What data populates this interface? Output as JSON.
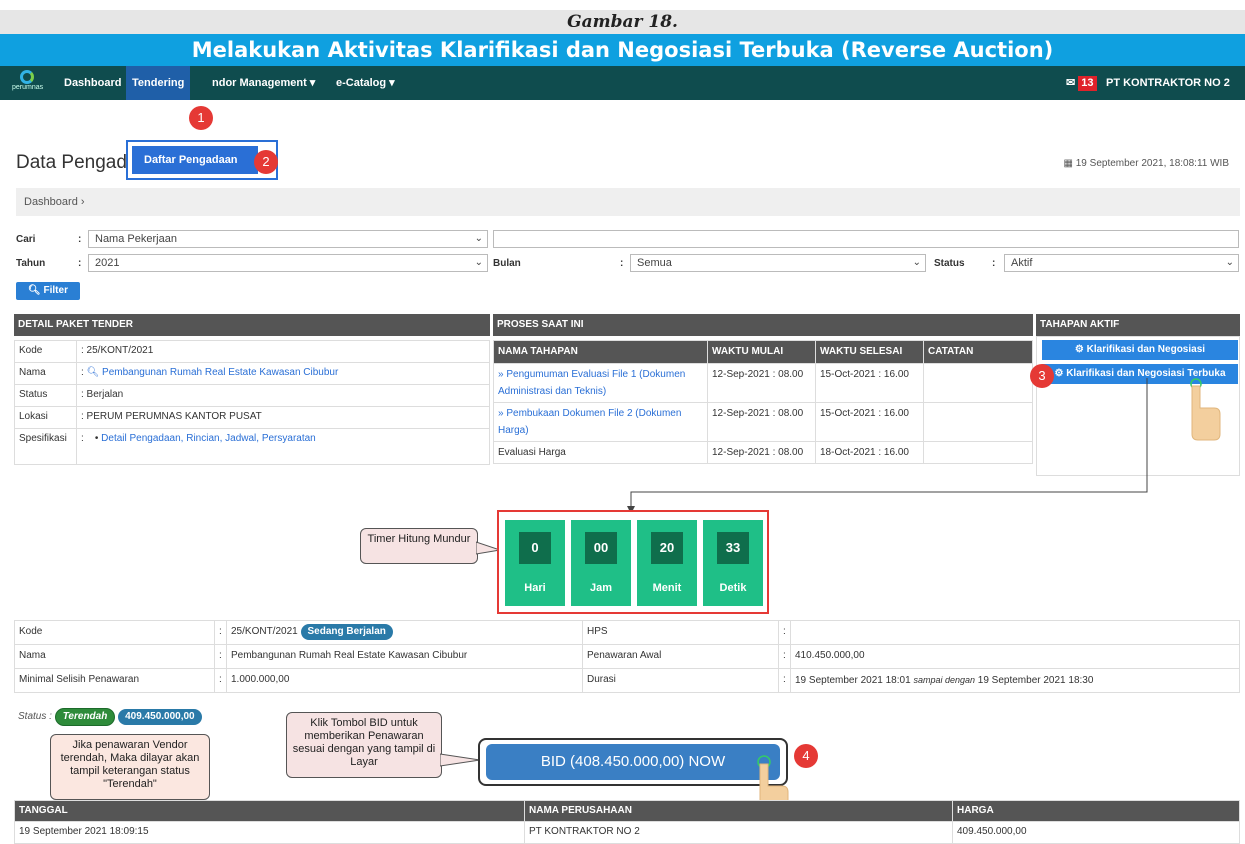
{
  "caption": "Gambar 18.",
  "banner": "Melakukan Aktivitas Klarifikasi dan Negosiasi Terbuka (Reverse Auction)",
  "navbar": {
    "logo_text": "perumnas",
    "dashboard": "Dashboard",
    "tendering": "Tendering",
    "vendor": "ndor Management ▾",
    "ecatalog": "e-Catalog ▾",
    "mail_count": "13",
    "user": "PT KONTRAKTOR NO 2"
  },
  "dropdown": {
    "item": "Daftar Pengadaan"
  },
  "steps": [
    "1",
    "2",
    "3",
    "4"
  ],
  "page_title": "Data Pengad",
  "datetime": "19 September 2021, 18:08:11 WIB",
  "breadcrumb": "Dashboard ›",
  "filter": {
    "cari_label": "Cari",
    "cari_value": "Nama Pekerjaan",
    "tahun_label": "Tahun",
    "tahun_value": "2021",
    "bulan_label": "Bulan",
    "bulan_value": "Semua",
    "status_label": "Status",
    "status_value": "Aktif",
    "button": "Filter"
  },
  "detail": {
    "heading": "DETAIL PAKET TENDER",
    "kode_label": "Kode",
    "kode": ": 25/KONT/2021",
    "nama_label": "Nama",
    "nama": "Pembangunan Rumah Real Estate Kawasan Cibubur",
    "status_label": "Status",
    "status": ": Berjalan",
    "lokasi_label": "Lokasi",
    "lokasi": ": PERUM PERUMNAS KANTOR PUSAT",
    "spesifikasi_label": "Spesifikasi",
    "spesifikasi": "Detail Pengadaan, Rincian, Jadwal, Persyaratan"
  },
  "proses": {
    "heading": "PROSES SAAT INI",
    "cols": [
      "NAMA TAHAPAN",
      "WAKTU MULAI",
      "WAKTU SELESAI",
      "CATATAN"
    ],
    "rows": [
      {
        "nama": "» Pengumuman Evaluasi File 1 (Dokumen Administrasi dan Teknis)",
        "mulai": "12-Sep-2021 : 08.00",
        "selesai": "15-Oct-2021 : 16.00"
      },
      {
        "nama": "» Pembukaan Dokumen File 2 (Dokumen Harga)",
        "mulai": "12-Sep-2021 : 08.00",
        "selesai": "15-Oct-2021 : 16.00"
      },
      {
        "nama": "Evaluasi Harga",
        "mulai": "12-Sep-2021 : 08.00",
        "selesai": "18-Oct-2021 : 16.00"
      }
    ]
  },
  "tahapan": {
    "heading": "TAHAPAN AKTIF",
    "btn1": "Klarifikasi dan Negosiasi",
    "btn2": "Klarifikasi dan Negosiasi Terbuka"
  },
  "timer": {
    "callout": "Timer Hitung Mundur",
    "hari": "0",
    "hari_label": "Hari",
    "jam": "00",
    "jam_label": "Jam",
    "menit": "20",
    "menit_label": "Menit",
    "detik": "33",
    "detik_label": "Detik"
  },
  "info": {
    "kode_label": "Kode",
    "kode": "25/KONT/2021",
    "kode_badge": "Sedang Berjalan",
    "hps_label": "HPS",
    "nama_label": "Nama",
    "nama": "Pembangunan Rumah Real Estate Kawasan Cibubur",
    "penawaran_label": "Penawaran Awal",
    "penawaran": "410.450.000,00",
    "minimal_label": "Minimal Selisih Penawaran",
    "minimal": "1.000.000,00",
    "durasi_label": "Durasi",
    "durasi_start": "19 September 2021 18:01",
    "durasi_mid": "sampai dengan",
    "durasi_end": "19 September 2021 18:30"
  },
  "status": {
    "label": "Status :",
    "badge": "Terendah",
    "amount": "409.450.000,00",
    "callout": "Jika penawaran Vendor terendah, Maka dilayar akan tampil keterangan status \"Terendah\""
  },
  "bid": {
    "callout": "Klik Tombol BID untuk memberikan Penawaran sesuai dengan yang tampil di Layar",
    "button": "BID (408.450.000,00) NOW"
  },
  "history": {
    "cols": [
      "TANGGAL",
      "NAMA PERUSAHAAN",
      "HARGA"
    ],
    "row": {
      "tanggal": "19 September 2021 18:09:15",
      "perusahaan": "PT KONTRAKTOR NO 2",
      "harga": "409.450.000,00"
    }
  }
}
